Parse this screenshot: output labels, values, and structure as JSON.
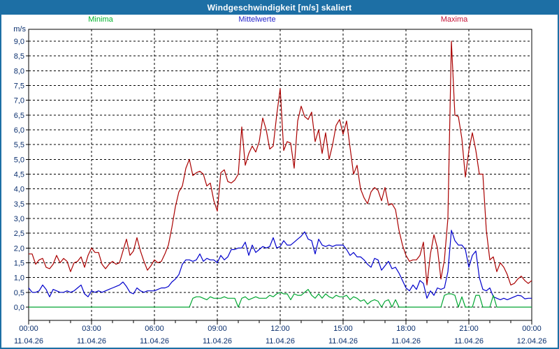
{
  "window": {
    "title": "Windgeschwindigkeit [m/s] skaliert"
  },
  "colors": {
    "frame": "#1d6fa5",
    "axis_text": "#0a2f6e",
    "minima": "#00b42d",
    "mittelwerte": "#2222cc",
    "maxima": "#c41236"
  },
  "legend": [
    {
      "label": "Minima",
      "color": "#00b42d",
      "x": 144
    },
    {
      "label": "Mittelwerte",
      "color": "#2222cc",
      "x": 368
    },
    {
      "label": "Maxima",
      "color": "#c41236",
      "x": 650
    }
  ],
  "axes": {
    "y_unit": "m/s",
    "y_tick_labels": [
      "0,0",
      "0,5",
      "1,0",
      "1,5",
      "2,0",
      "2,5",
      "3,0",
      "3,5",
      "4,0",
      "4,5",
      "5,0",
      "5,5",
      "6,0",
      "6,5",
      "7,0",
      "7,5",
      "8,0",
      "8,5",
      "9,0"
    ],
    "x_ticks": [
      {
        "time": "00:00",
        "date": "11.04.26"
      },
      {
        "time": "03:00",
        "date": "11.04.26"
      },
      {
        "time": "06:00",
        "date": "11.04.26"
      },
      {
        "time": "09:00",
        "date": "11.04.26"
      },
      {
        "time": "12:00",
        "date": "11.04.26"
      },
      {
        "time": "15:00",
        "date": "11.04.26"
      },
      {
        "time": "18:00",
        "date": "11.04.26"
      },
      {
        "time": "21:00",
        "date": "11.04.26"
      },
      {
        "time": "00:00",
        "date": "12.04.26"
      }
    ]
  },
  "chart_data": {
    "type": "line",
    "title": "Windgeschwindigkeit [m/s] skaliert",
    "ylabel": "m/s",
    "ylim": [
      -0.45,
      9.4
    ],
    "y_tick_step": 0.5,
    "grid": true,
    "x_start": "00:00",
    "x_end": "24:00",
    "x_interval_minutes": 10,
    "x_major_tick_hours": 3,
    "series": [
      {
        "name": "Maxima",
        "color": "#aa0000",
        "values": [
          1.8,
          1.8,
          1.45,
          1.6,
          1.65,
          1.35,
          1.3,
          1.45,
          1.75,
          1.5,
          1.65,
          1.55,
          1.2,
          1.5,
          1.55,
          1.7,
          1.35,
          1.75,
          2.0,
          1.85,
          1.85,
          1.45,
          1.3,
          1.45,
          1.55,
          1.45,
          1.5,
          1.9,
          2.3,
          1.75,
          1.9,
          2.35,
          1.9,
          1.55,
          1.25,
          1.4,
          1.6,
          1.5,
          1.55,
          1.8,
          2.1,
          2.7,
          3.4,
          3.9,
          4.1,
          4.7,
          5.0,
          4.45,
          4.55,
          4.6,
          4.5,
          4.1,
          4.2,
          3.6,
          3.25,
          4.55,
          4.65,
          4.25,
          4.2,
          4.3,
          4.5,
          6.1,
          4.8,
          5.2,
          5.45,
          5.25,
          5.6,
          6.4,
          6.0,
          5.35,
          5.45,
          6.5,
          7.4,
          5.3,
          5.6,
          5.55,
          4.7,
          6.3,
          6.8,
          6.45,
          6.35,
          6.6,
          5.6,
          6.0,
          5.2,
          5.9,
          5.0,
          5.5,
          6.15,
          6.35,
          5.85,
          6.3,
          5.4,
          4.5,
          4.8,
          4.0,
          3.7,
          3.5,
          3.9,
          4.05,
          3.95,
          3.6,
          4.05,
          3.45,
          3.5,
          3.3,
          2.6,
          2.1,
          1.75,
          1.55,
          1.6,
          1.6,
          1.75,
          2.2,
          0.75,
          1.8,
          2.45,
          2.0,
          0.95,
          1.6,
          3.0,
          9.0,
          6.5,
          6.45,
          5.7,
          4.4,
          5.3,
          5.9,
          5.3,
          4.5,
          4.5,
          2.6,
          1.6,
          1.7,
          1.2,
          1.5,
          1.35,
          1.1,
          0.75,
          0.8,
          0.95,
          1.05,
          0.9,
          0.8,
          0.9
        ]
      },
      {
        "name": "Mittelwerte",
        "color": "#0000cc",
        "values": [
          0.65,
          0.5,
          0.5,
          0.55,
          0.75,
          0.6,
          0.35,
          0.6,
          0.55,
          0.5,
          0.5,
          0.55,
          0.5,
          0.55,
          0.65,
          0.75,
          0.45,
          0.35,
          0.55,
          0.5,
          0.55,
          0.5,
          0.55,
          0.6,
          0.65,
          0.7,
          0.75,
          0.85,
          0.7,
          0.5,
          0.45,
          0.65,
          0.55,
          0.5,
          0.55,
          0.55,
          0.55,
          0.6,
          0.65,
          0.65,
          0.7,
          0.85,
          0.95,
          1.1,
          1.45,
          1.6,
          1.6,
          1.55,
          1.6,
          1.8,
          1.55,
          1.65,
          1.6,
          1.6,
          1.5,
          1.75,
          1.6,
          1.7,
          1.95,
          1.95,
          2.0,
          2.0,
          2.2,
          1.75,
          2.1,
          1.85,
          1.95,
          2.05,
          2.0,
          2.05,
          2.35,
          2.0,
          2.05,
          2.25,
          2.1,
          2.1,
          2.2,
          2.3,
          2.4,
          2.55,
          2.3,
          2.25,
          1.8,
          2.3,
          2.1,
          2.05,
          2.1,
          2.05,
          2.1,
          2.1,
          2.1,
          1.95,
          1.75,
          1.85,
          1.7,
          1.7,
          1.6,
          1.45,
          1.35,
          1.65,
          1.6,
          1.25,
          1.4,
          1.55,
          1.3,
          1.35,
          1.15,
          0.9,
          0.65,
          0.55,
          0.75,
          0.6,
          0.9,
          0.8,
          0.3,
          0.55,
          0.4,
          0.65,
          0.6,
          0.65,
          1.2,
          2.6,
          2.25,
          2.1,
          2.1,
          1.95,
          1.35,
          1.75,
          1.9,
          1.0,
          0.6,
          0.55,
          0.65,
          0.35,
          0.3,
          0.25,
          0.3,
          0.25,
          0.3,
          0.35,
          0.4,
          0.38,
          0.28,
          0.3,
          0.3
        ]
      },
      {
        "name": "Minima",
        "color": "#00a531",
        "values": [
          0,
          0,
          0,
          0,
          0,
          0,
          0,
          0,
          0,
          0,
          0,
          0,
          0,
          0,
          0,
          0,
          0,
          0,
          0,
          0,
          0,
          0,
          0,
          0,
          0,
          0,
          0,
          0,
          0,
          0,
          0,
          0,
          0,
          0,
          0,
          0,
          0,
          0,
          0,
          0,
          0,
          0,
          0,
          0,
          0,
          0,
          0,
          0.3,
          0.35,
          0.35,
          0.3,
          0.25,
          0.35,
          0.3,
          0.3,
          0.3,
          0.35,
          0.3,
          0.3,
          0.3,
          0.0,
          0.3,
          0.35,
          0.25,
          0.3,
          0.35,
          0.3,
          0.3,
          0.3,
          0.4,
          0.35,
          0.45,
          0.5,
          0.45,
          0.45,
          0.25,
          0.45,
          0.4,
          0.4,
          0.5,
          0.6,
          0.4,
          0.3,
          0.45,
          0.3,
          0.45,
          0.35,
          0.3,
          0.4,
          0.35,
          0.35,
          0.4,
          0.25,
          0.35,
          0.3,
          0.2,
          0.25,
          0.1,
          0.2,
          0.25,
          0.2,
          0.0,
          0.2,
          0.25,
          0.0,
          0.25,
          0,
          0,
          0,
          0,
          0,
          0,
          0,
          0,
          0,
          0,
          0,
          0,
          0,
          0.4,
          0.45,
          0.45,
          0.4,
          0.0,
          0.35,
          0.0,
          0.0,
          0.0,
          0.4,
          0.4,
          0.0,
          0.0,
          0.0,
          0.4,
          0,
          0,
          0,
          0,
          0,
          0,
          0,
          0,
          0,
          0,
          0
        ]
      }
    ]
  }
}
